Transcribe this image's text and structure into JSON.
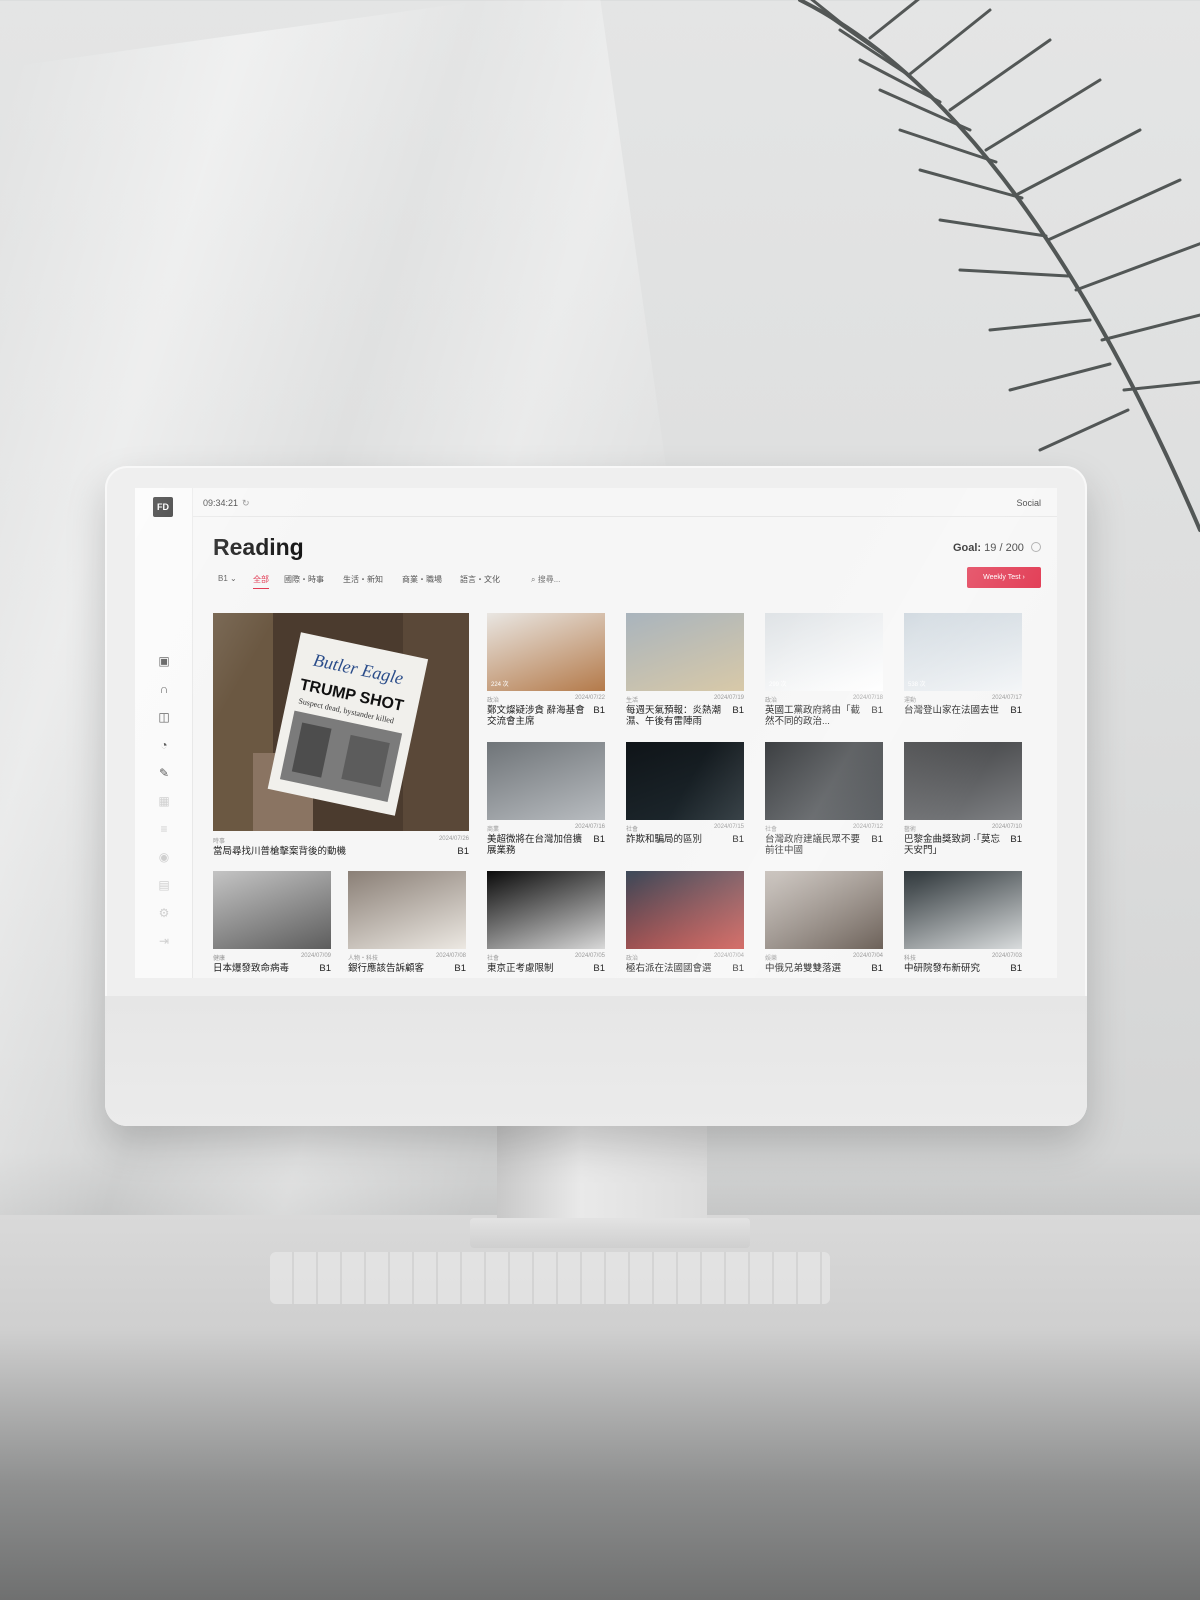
{
  "app": {
    "logo": "FD",
    "clock": "09:34:21",
    "social": "Social"
  },
  "page": {
    "title": "Reading",
    "goal_label": "Goal:",
    "goal_value": "19 / 200"
  },
  "filters": {
    "level": "B1 ⌄",
    "tabs": [
      "全部",
      "國際・時事",
      "生活・新知",
      "商業・職場",
      "語言・文化"
    ],
    "search_placeholder": "搜尋...",
    "weekly_test": "Weekly Test  ›"
  },
  "featured": {
    "category": "時事",
    "date": "2024/07/26",
    "title": "當局尋找川普槍擊案背後的動機",
    "level": "B1"
  },
  "cards": [
    {
      "views": "224 次",
      "category": "政治",
      "date": "2024/07/22",
      "title": "鄭文燦疑涉貪 辭海基會交流會主席",
      "level": "B1"
    },
    {
      "views": "",
      "category": "生活",
      "date": "2024/07/19",
      "title": "每週天氣預報：炎熱潮濕、午後有雷陣雨",
      "level": "B1"
    },
    {
      "views": "299 次",
      "category": "政治",
      "date": "2024/07/18",
      "title": "英國工黨政府將由「截然不同的政治...",
      "level": "B1"
    },
    {
      "views": "538 次",
      "category": "運動",
      "date": "2024/07/17",
      "title": "台灣登山家在法國去世",
      "level": "B1"
    },
    {
      "views": "",
      "category": "商業",
      "date": "2024/07/16",
      "title": "美超微將在台灣加倍擴展業務",
      "level": "B1"
    },
    {
      "views": "",
      "category": "社會",
      "date": "2024/07/15",
      "title": "詐欺和騙局的區別",
      "level": "B1"
    },
    {
      "views": "",
      "category": "社會",
      "date": "2024/07/12",
      "title": "台灣政府建議民眾不要前往中國",
      "level": "B1"
    },
    {
      "views": "",
      "category": "藝術",
      "date": "2024/07/10",
      "title": "巴黎金曲獎致詞 ·「莫忘天安門」",
      "level": "B1"
    },
    {
      "views": "",
      "category": "健康",
      "date": "2024/07/09",
      "title": "日本爆發致命病毒",
      "level": "B1"
    },
    {
      "views": "",
      "category": "人物・科技",
      "date": "2024/07/08",
      "title": "銀行應該告訴顧客",
      "level": "B1"
    },
    {
      "views": "",
      "category": "社會",
      "date": "2024/07/05",
      "title": "東京正考慮限制",
      "level": "B1"
    },
    {
      "views": "",
      "category": "政治",
      "date": "2024/07/04",
      "title": "極右派在法國國會選",
      "level": "B1"
    },
    {
      "views": "",
      "category": "娛樂",
      "date": "2024/07/04",
      "title": "中俄兄弟雙雙落選",
      "level": "B1"
    },
    {
      "views": "",
      "category": "科技",
      "date": "2024/07/03",
      "title": "中研院發布新研究",
      "level": "B1"
    }
  ],
  "colors": {
    "accent": "#e0314b",
    "text": "#222222",
    "muted": "#9a9a9a"
  },
  "newspaper": {
    "masthead": "Butler Eagle",
    "headline": "TRUMP SHOT",
    "subhead": "Suspect dead, bystander killed"
  }
}
